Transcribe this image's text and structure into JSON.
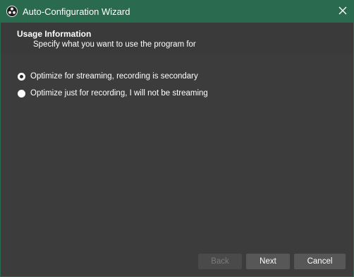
{
  "window": {
    "title": "Auto-Configuration Wizard",
    "accent_color": "#2a6b4f"
  },
  "header": {
    "title": "Usage Information",
    "subtitle": "Specify what you want to use the program for"
  },
  "options": [
    {
      "label": "Optimize for streaming, recording is secondary",
      "selected": true
    },
    {
      "label": "Optimize just for recording, I will not be streaming",
      "selected": false
    }
  ],
  "buttons": {
    "back_label": "Back",
    "next_label": "Next",
    "cancel_label": "Cancel"
  },
  "icons": {
    "app": "obs-logo-icon",
    "close": "close-icon"
  }
}
